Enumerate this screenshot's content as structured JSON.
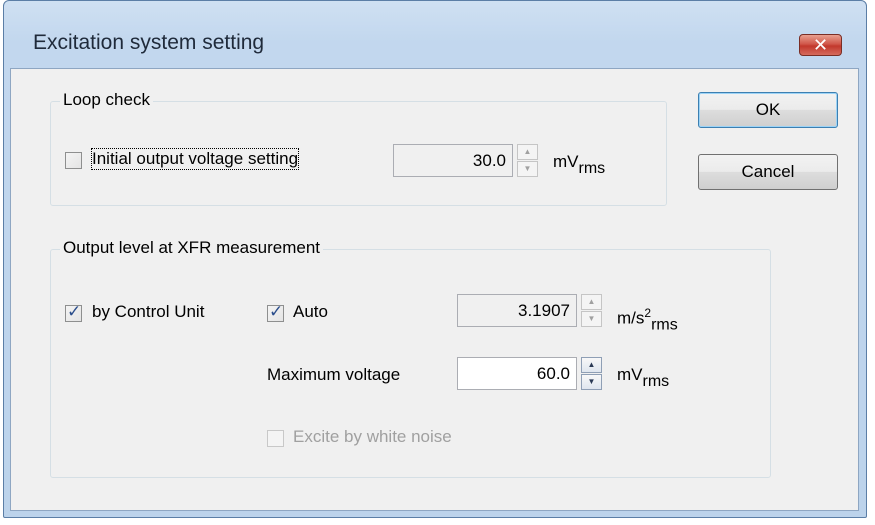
{
  "window": {
    "title": "Excitation system setting",
    "close_glyph": "✕"
  },
  "loop_check": {
    "legend": "Loop check",
    "initial_voltage_checkbox": {
      "label": "Initial output voltage setting",
      "checked": false
    },
    "voltage_value": "30.0",
    "unit_main": "mV",
    "unit_sub": "rms"
  },
  "xfr": {
    "legend": "Output level at XFR measurement",
    "by_control_unit": {
      "label": "by Control Unit",
      "checked": true
    },
    "auto": {
      "label": "Auto",
      "checked": true
    },
    "accel_value": "3.1907",
    "accel_unit_main": "m/s",
    "accel_unit_sup": "2",
    "accel_unit_sub": "rms",
    "max_voltage_label": "Maximum voltage",
    "max_voltage_value": "60.0",
    "max_voltage_unit_main": "mV",
    "max_voltage_unit_sub": "rms",
    "white_noise": {
      "label": "Excite by white noise",
      "checked": false,
      "enabled": false
    }
  },
  "buttons": {
    "ok": "OK",
    "cancel": "Cancel"
  },
  "icons": {
    "spin_up": "▲",
    "spin_down": "▼"
  },
  "colors": {
    "title_bar": "#c2d7ee",
    "close_button": "#c2382c",
    "client_bg": "#f0f0f0"
  }
}
